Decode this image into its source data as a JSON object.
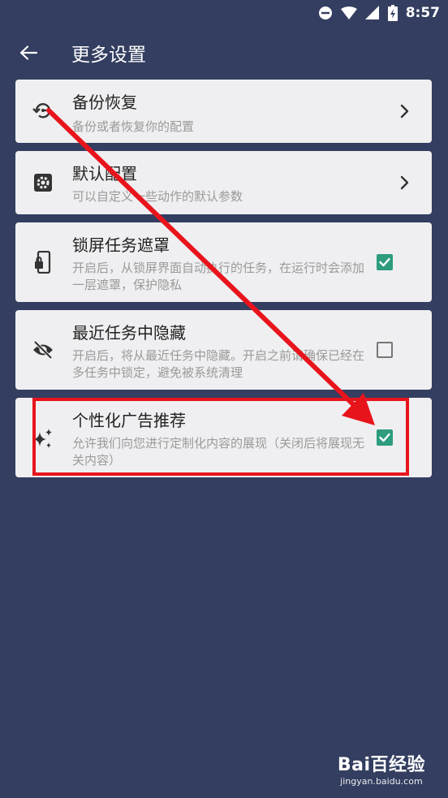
{
  "status_bar": {
    "time": "8:57"
  },
  "header": {
    "title": "更多设置"
  },
  "settings": [
    {
      "title": "备份恢复",
      "desc": "备份或者恢复你的配置",
      "control": "chevron"
    },
    {
      "title": "默认配置",
      "desc": "可以自定义一些动作的默认参数",
      "control": "chevron"
    },
    {
      "title": "锁屏任务遮罩",
      "desc": "开启后，从锁屏界面自动执行的任务，在运行时会添加一层遮罩，保护隐私",
      "control": "checkbox",
      "checked": true
    },
    {
      "title": "最近任务中隐藏",
      "desc": "开启后，将从最近任务中隐藏。开启之前请确保已经在多任务中锁定，避免被系统清理",
      "control": "checkbox",
      "checked": false
    },
    {
      "title": "个性化广告推荐",
      "desc": "允许我们向您进行定制化内容的展现（关闭后将展现无关内容）",
      "control": "checkbox",
      "checked": true
    }
  ],
  "watermark": {
    "brand": "Bai百经验",
    "url": "jingyan.baidu.com"
  },
  "colors": {
    "background": "#333E60",
    "card": "#EFEFF1",
    "accent": "#2E9C7E",
    "annotation": "#E8141C"
  }
}
